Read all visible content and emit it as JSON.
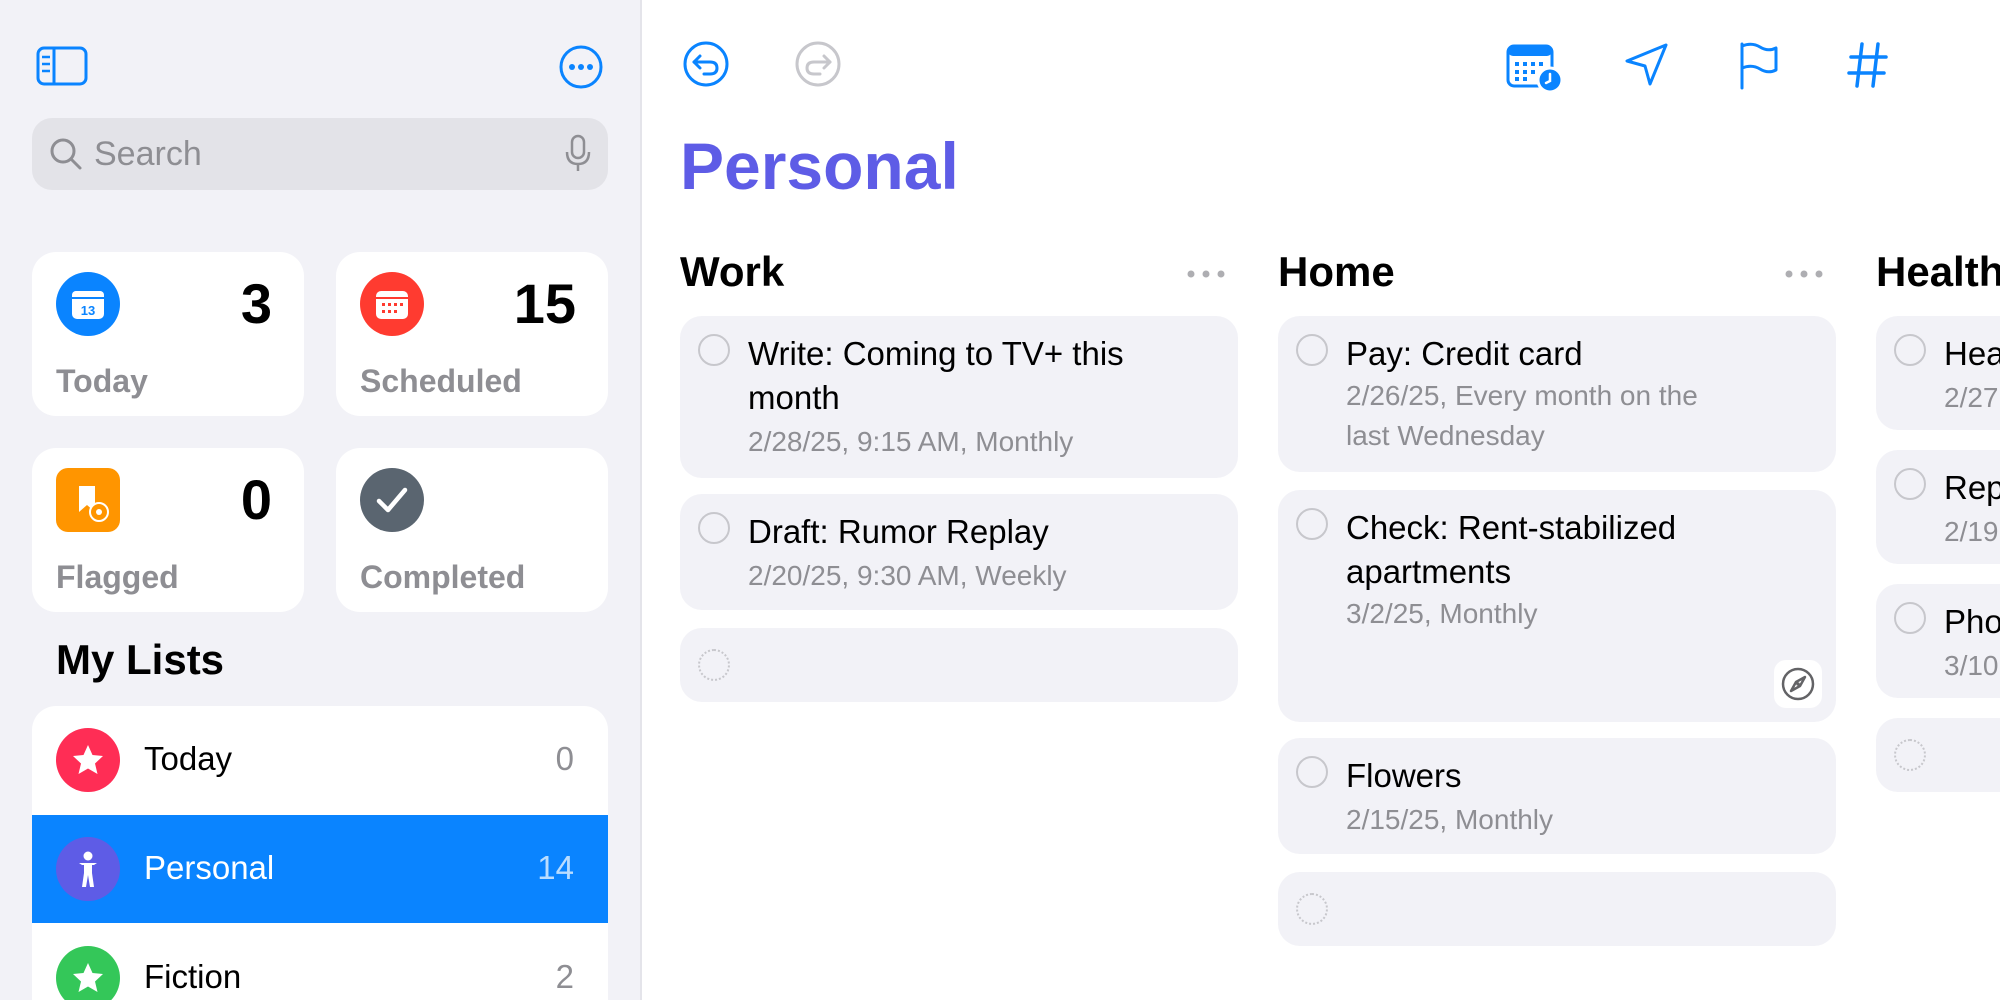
{
  "search": {
    "placeholder": "Search"
  },
  "smart_lists": [
    {
      "label": "Today",
      "count": "3",
      "icon": "calendar-icon",
      "icon_text": "13",
      "color": "#0a84ff"
    },
    {
      "label": "Scheduled",
      "count": "15",
      "icon": "calendar-grid-icon",
      "color": "#ff3b30"
    },
    {
      "label": "Flagged",
      "count": "0",
      "icon": "flag-icon",
      "color": "#ff9500"
    },
    {
      "label": "Completed",
      "count": "",
      "icon": "checkmark-icon",
      "color": "#5a6570"
    }
  ],
  "my_lists": {
    "title": "My Lists",
    "items": [
      {
        "name": "Today",
        "count": "0",
        "icon": "star-icon",
        "color": "#ff2d55"
      },
      {
        "name": "Personal",
        "count": "14",
        "icon": "person-icon",
        "color": "#5e5ce6",
        "selected": true
      },
      {
        "name": "Fiction",
        "count": "2",
        "icon": "star-icon",
        "color": "#34c759"
      }
    ]
  },
  "toolbar": {
    "icons": [
      "undo-icon",
      "redo-icon",
      "calendar-clock-icon",
      "location-icon",
      "flag-icon",
      "hashtag-icon"
    ],
    "accent": "#0a84ff"
  },
  "main": {
    "title": "Personal",
    "title_color": "#5e5ce6",
    "columns": [
      {
        "title": "Work",
        "tasks": [
          {
            "title": "Write: Coming to TV+ this month",
            "subtitle": "2/28/25, 9:15 AM, Monthly"
          },
          {
            "title": "Draft: Rumor Replay",
            "subtitle": "2/20/25, 9:30 AM, Weekly"
          }
        ]
      },
      {
        "title": "Home",
        "tasks": [
          {
            "title": "Pay: Credit card",
            "subtitle": "2/26/25, Every month on the last Wednesday"
          },
          {
            "title": "Check: Rent-stabilized apartments",
            "subtitle": "3/2/25, Monthly",
            "has_url": true
          },
          {
            "title": "Flowers",
            "subtitle": "2/15/25, Monthly"
          }
        ]
      },
      {
        "title": "Health",
        "tasks": [
          {
            "title": "Hea",
            "subtitle": "2/27"
          },
          {
            "title": "Rep",
            "subtitle": "2/19"
          },
          {
            "title": "Pho",
            "subtitle": "3/10"
          }
        ]
      }
    ]
  }
}
